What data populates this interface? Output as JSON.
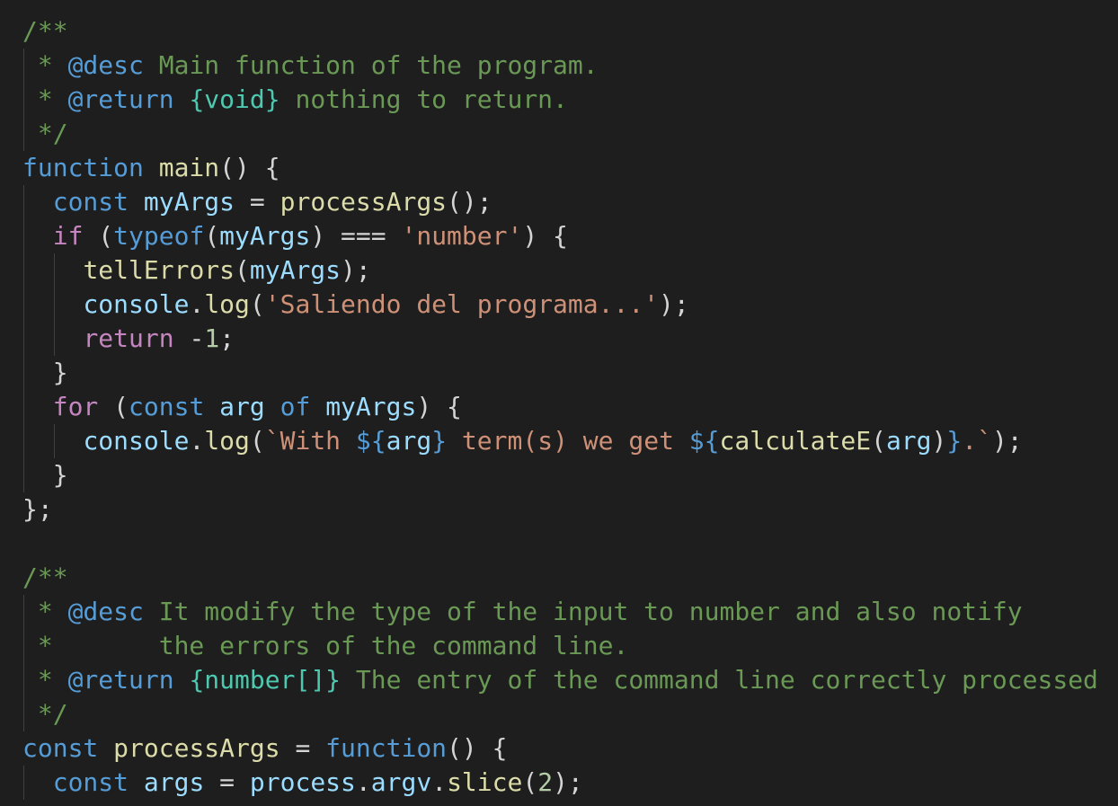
{
  "editor": {
    "language": "javascript",
    "theme_colors": {
      "background": "#1e1e1e",
      "comment": "#6a9955",
      "keyword": "#569cd6",
      "control": "#c586c0",
      "function": "#dcdcaa",
      "variable": "#9cdcfe",
      "string": "#ce9178",
      "number": "#b5cea8",
      "type": "#4ec9b0",
      "text": "#d4d4d4"
    },
    "lines": [
      {
        "guides": 0,
        "tokens": [
          {
            "c": "t-comment",
            "t": "/**"
          }
        ]
      },
      {
        "guides": 1,
        "tokens": [
          {
            "c": "t-comment",
            "t": " * "
          },
          {
            "c": "t-tag",
            "t": "@desc"
          },
          {
            "c": "t-comment",
            "t": " Main function of the program."
          }
        ]
      },
      {
        "guides": 1,
        "tokens": [
          {
            "c": "t-comment",
            "t": " * "
          },
          {
            "c": "t-tag",
            "t": "@return"
          },
          {
            "c": "t-comment",
            "t": " "
          },
          {
            "c": "t-type",
            "t": "{void}"
          },
          {
            "c": "t-comment",
            "t": " nothing to return."
          }
        ]
      },
      {
        "guides": 1,
        "tokens": [
          {
            "c": "t-comment",
            "t": " */"
          }
        ]
      },
      {
        "guides": 0,
        "tokens": [
          {
            "c": "t-keyword",
            "t": "function"
          },
          {
            "c": "t-punct",
            "t": " "
          },
          {
            "c": "t-func",
            "t": "main"
          },
          {
            "c": "t-punct",
            "t": "() {"
          }
        ]
      },
      {
        "guides": 1,
        "tokens": [
          {
            "c": "t-punct",
            "t": "  "
          },
          {
            "c": "t-keyword",
            "t": "const"
          },
          {
            "c": "t-punct",
            "t": " "
          },
          {
            "c": "t-var",
            "t": "myArgs"
          },
          {
            "c": "t-punct",
            "t": " = "
          },
          {
            "c": "t-func",
            "t": "processArgs"
          },
          {
            "c": "t-punct",
            "t": "();"
          }
        ]
      },
      {
        "guides": 1,
        "tokens": [
          {
            "c": "t-punct",
            "t": "  "
          },
          {
            "c": "t-control",
            "t": "if"
          },
          {
            "c": "t-punct",
            "t": " ("
          },
          {
            "c": "t-keyword",
            "t": "typeof"
          },
          {
            "c": "t-punct",
            "t": "("
          },
          {
            "c": "t-var",
            "t": "myArgs"
          },
          {
            "c": "t-punct",
            "t": ") === "
          },
          {
            "c": "t-string",
            "t": "'number'"
          },
          {
            "c": "t-punct",
            "t": ") {"
          }
        ]
      },
      {
        "guides": 2,
        "tokens": [
          {
            "c": "t-punct",
            "t": "    "
          },
          {
            "c": "t-func",
            "t": "tellErrors"
          },
          {
            "c": "t-punct",
            "t": "("
          },
          {
            "c": "t-var",
            "t": "myArgs"
          },
          {
            "c": "t-punct",
            "t": ");"
          }
        ]
      },
      {
        "guides": 2,
        "tokens": [
          {
            "c": "t-punct",
            "t": "    "
          },
          {
            "c": "t-var",
            "t": "console"
          },
          {
            "c": "t-punct",
            "t": "."
          },
          {
            "c": "t-func",
            "t": "log"
          },
          {
            "c": "t-punct",
            "t": "("
          },
          {
            "c": "t-string",
            "t": "'Saliendo del programa...'"
          },
          {
            "c": "t-punct",
            "t": ");"
          }
        ]
      },
      {
        "guides": 2,
        "tokens": [
          {
            "c": "t-punct",
            "t": "    "
          },
          {
            "c": "t-control",
            "t": "return"
          },
          {
            "c": "t-punct",
            "t": " -"
          },
          {
            "c": "t-number",
            "t": "1"
          },
          {
            "c": "t-punct",
            "t": ";"
          }
        ]
      },
      {
        "guides": 1,
        "tokens": [
          {
            "c": "t-punct",
            "t": "  }"
          }
        ]
      },
      {
        "guides": 1,
        "tokens": [
          {
            "c": "t-punct",
            "t": "  "
          },
          {
            "c": "t-control",
            "t": "for"
          },
          {
            "c": "t-punct",
            "t": " ("
          },
          {
            "c": "t-keyword",
            "t": "const"
          },
          {
            "c": "t-punct",
            "t": " "
          },
          {
            "c": "t-var",
            "t": "arg"
          },
          {
            "c": "t-punct",
            "t": " "
          },
          {
            "c": "t-keyword",
            "t": "of"
          },
          {
            "c": "t-punct",
            "t": " "
          },
          {
            "c": "t-var",
            "t": "myArgs"
          },
          {
            "c": "t-punct",
            "t": ") {"
          }
        ]
      },
      {
        "guides": 2,
        "tokens": [
          {
            "c": "t-punct",
            "t": "    "
          },
          {
            "c": "t-var",
            "t": "console"
          },
          {
            "c": "t-punct",
            "t": "."
          },
          {
            "c": "t-func",
            "t": "log"
          },
          {
            "c": "t-punct",
            "t": "("
          },
          {
            "c": "t-string",
            "t": "`With "
          },
          {
            "c": "t-interp",
            "t": "${"
          },
          {
            "c": "t-var",
            "t": "arg"
          },
          {
            "c": "t-interp",
            "t": "}"
          },
          {
            "c": "t-string",
            "t": " term(s) we get "
          },
          {
            "c": "t-interp",
            "t": "${"
          },
          {
            "c": "t-func",
            "t": "calculateE"
          },
          {
            "c": "t-punct",
            "t": "("
          },
          {
            "c": "t-var",
            "t": "arg"
          },
          {
            "c": "t-punct",
            "t": ")"
          },
          {
            "c": "t-interp",
            "t": "}"
          },
          {
            "c": "t-string",
            "t": ".`"
          },
          {
            "c": "t-punct",
            "t": ");"
          }
        ]
      },
      {
        "guides": 1,
        "tokens": [
          {
            "c": "t-punct",
            "t": "  }"
          }
        ]
      },
      {
        "guides": 0,
        "tokens": [
          {
            "c": "t-punct",
            "t": "};"
          }
        ]
      },
      {
        "guides": 0,
        "tokens": []
      },
      {
        "guides": 0,
        "tokens": [
          {
            "c": "t-comment",
            "t": "/**"
          }
        ]
      },
      {
        "guides": 1,
        "tokens": [
          {
            "c": "t-comment",
            "t": " * "
          },
          {
            "c": "t-tag",
            "t": "@desc"
          },
          {
            "c": "t-comment",
            "t": " It modify the type of the input to number and also notify"
          }
        ]
      },
      {
        "guides": 1,
        "tokens": [
          {
            "c": "t-comment",
            "t": " *       the errors of the command line."
          }
        ]
      },
      {
        "guides": 1,
        "tokens": [
          {
            "c": "t-comment",
            "t": " * "
          },
          {
            "c": "t-tag",
            "t": "@return"
          },
          {
            "c": "t-comment",
            "t": " "
          },
          {
            "c": "t-type",
            "t": "{number[]}"
          },
          {
            "c": "t-comment",
            "t": " The entry of the command line correctly processed"
          }
        ]
      },
      {
        "guides": 1,
        "tokens": [
          {
            "c": "t-comment",
            "t": " */"
          }
        ]
      },
      {
        "guides": 0,
        "tokens": [
          {
            "c": "t-keyword",
            "t": "const"
          },
          {
            "c": "t-punct",
            "t": " "
          },
          {
            "c": "t-func",
            "t": "processArgs"
          },
          {
            "c": "t-punct",
            "t": " = "
          },
          {
            "c": "t-keyword",
            "t": "function"
          },
          {
            "c": "t-punct",
            "t": "() {"
          }
        ]
      },
      {
        "guides": 1,
        "tokens": [
          {
            "c": "t-punct",
            "t": "  "
          },
          {
            "c": "t-keyword",
            "t": "const"
          },
          {
            "c": "t-punct",
            "t": " "
          },
          {
            "c": "t-var",
            "t": "args"
          },
          {
            "c": "t-punct",
            "t": " = "
          },
          {
            "c": "t-var",
            "t": "process"
          },
          {
            "c": "t-punct",
            "t": "."
          },
          {
            "c": "t-var",
            "t": "argv"
          },
          {
            "c": "t-punct",
            "t": "."
          },
          {
            "c": "t-func",
            "t": "slice"
          },
          {
            "c": "t-punct",
            "t": "("
          },
          {
            "c": "t-number",
            "t": "2"
          },
          {
            "c": "t-punct",
            "t": ");"
          }
        ]
      }
    ]
  }
}
